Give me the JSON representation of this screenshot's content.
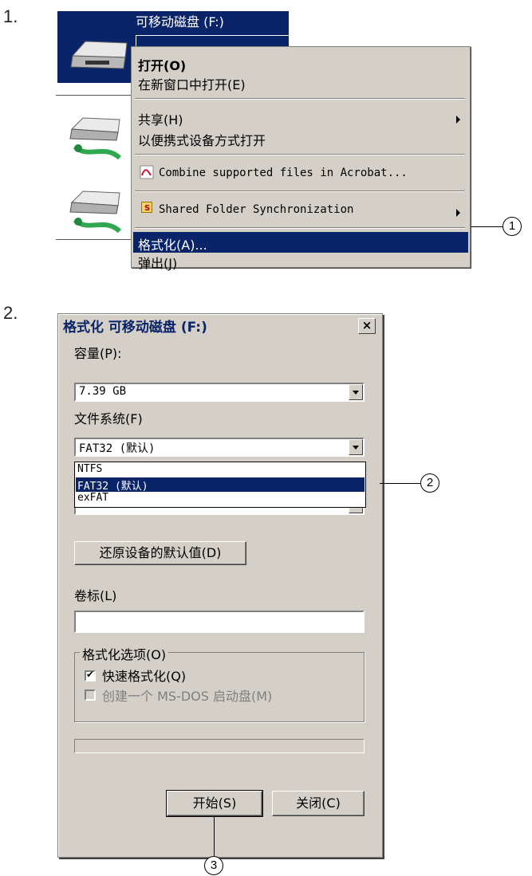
{
  "steps": {
    "one": "1.",
    "two": "2."
  },
  "explorer": {
    "selected_drive_label": "可移动磁盘 (F:)"
  },
  "context_menu": {
    "items": [
      {
        "label": "打开(O)",
        "bold": true
      },
      {
        "label": "在新窗口中打开(E)"
      },
      {
        "label": "共享(H)",
        "submenu": true
      },
      {
        "label": "以便携式设备方式打开"
      },
      {
        "label": "Combine supported files in Acrobat...",
        "icon": "acrobat-icon"
      },
      {
        "label": "Shared Folder Synchronization",
        "icon": "sync-s-icon",
        "submenu": true
      },
      {
        "label": "格式化(A)...",
        "highlighted": true
      },
      {
        "label": "弹出(J)"
      }
    ]
  },
  "callouts": {
    "one": "1",
    "two": "2",
    "three": "3"
  },
  "dialog": {
    "title": "格式化 可移动磁盘 (F:)",
    "close_glyph": "×",
    "capacity_label": "容量(P):",
    "capacity_value": "7.39 GB",
    "filesystem_label": "文件系统(F)",
    "filesystem_value": "FAT32 (默认)",
    "filesystem_options": [
      "NTFS",
      "FAT32 (默认)",
      "exFAT"
    ],
    "filesystem_selected_index": 1,
    "restore_button": "还原设备的默认值(D)",
    "volume_label": "卷标(L)",
    "volume_value": "",
    "options_group": "格式化选项(O)",
    "quick_format": {
      "label": "快速格式化(Q)",
      "checked": true
    },
    "msdos_boot": {
      "label": "创建一个 MS-DOS 启动盘(M)",
      "checked": false,
      "enabled": false
    },
    "progress": 0,
    "start_button": "开始(S)",
    "close_button": "关闭(C)"
  },
  "colors": {
    "selection": "#0a246a",
    "dialog_bg": "#d4d0c8",
    "drive_green": "#2fa84f"
  }
}
